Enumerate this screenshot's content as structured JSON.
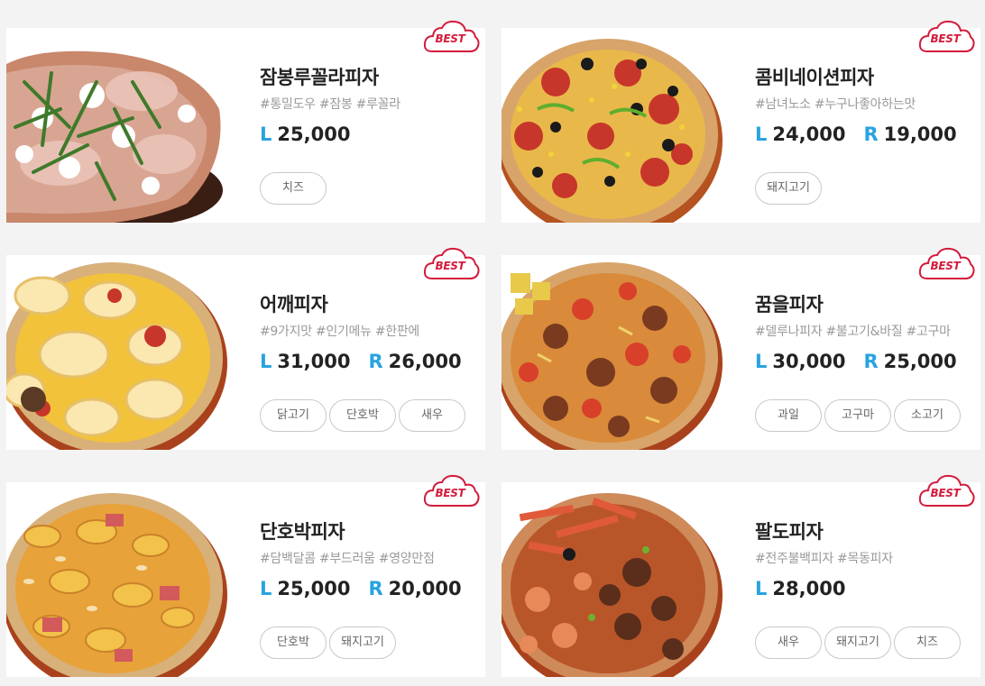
{
  "badge_label": "BEST",
  "price_colors": {
    "size_letter": "#28a3e0",
    "badge": "#d31c3c"
  },
  "menus": [
    {
      "name": "잠봉루꼴라피자",
      "tags": "#통밀도우 #잠봉 #루꼴라",
      "prices": [
        {
          "size": "L",
          "amount": "25,000"
        }
      ],
      "toppings": [
        "치즈"
      ],
      "image": "jambon-arugula-pizza"
    },
    {
      "name": "콤비네이션피자",
      "tags": "#남녀노소 #누구나좋아하는맛",
      "prices": [
        {
          "size": "L",
          "amount": "24,000"
        },
        {
          "size": "R",
          "amount": "19,000"
        }
      ],
      "toppings": [
        "돼지고기"
      ],
      "image": "combination-pizza"
    },
    {
      "name": "어깨피자",
      "tags": "#9가지맛 #인기메뉴 #한판에",
      "prices": [
        {
          "size": "L",
          "amount": "31,000"
        },
        {
          "size": "R",
          "amount": "26,000"
        }
      ],
      "toppings": [
        "닭고기",
        "단호박",
        "새우"
      ],
      "image": "eokkae-pizza"
    },
    {
      "name": "꿈을피자",
      "tags": "#델루나피자 #불고기&바질 #고구마",
      "prices": [
        {
          "size": "L",
          "amount": "30,000"
        },
        {
          "size": "R",
          "amount": "25,000"
        }
      ],
      "toppings": [
        "과일",
        "고구마",
        "소고기"
      ],
      "image": "dream-pizza"
    },
    {
      "name": "단호박피자",
      "tags": "#담백달콤 #부드러움 #영양만점",
      "prices": [
        {
          "size": "L",
          "amount": "25,000"
        },
        {
          "size": "R",
          "amount": "20,000"
        }
      ],
      "toppings": [
        "단호박",
        "돼지고기"
      ],
      "image": "pumpkin-pizza"
    },
    {
      "name": "팔도피자",
      "tags": "#전주불백피자 #목동피자",
      "prices": [
        {
          "size": "L",
          "amount": "28,000"
        }
      ],
      "toppings": [
        "새우",
        "돼지고기",
        "치즈"
      ],
      "image": "paldo-pizza"
    }
  ]
}
